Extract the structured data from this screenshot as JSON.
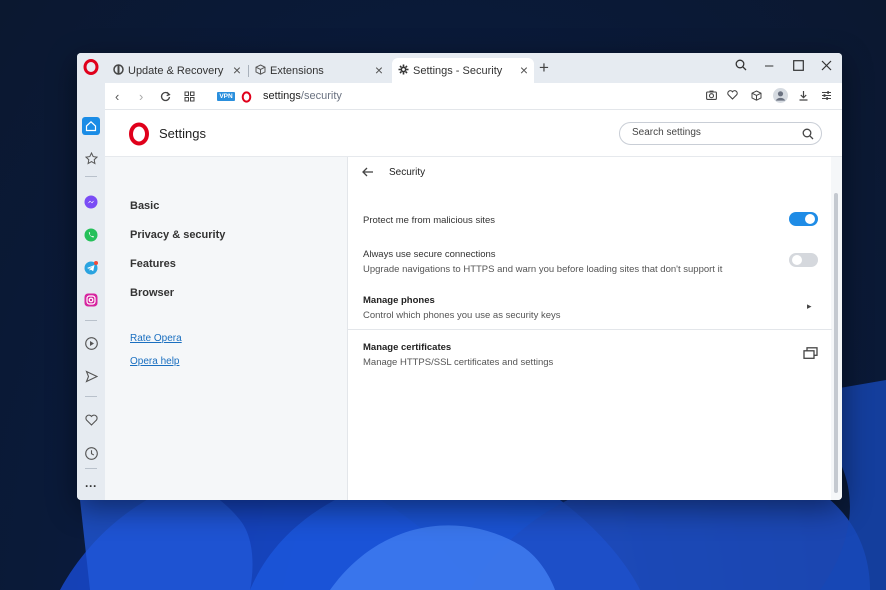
{
  "browser": {
    "tabs": [
      {
        "label": "Update & Recovery",
        "icon": "windows-settings-icon",
        "active": false
      },
      {
        "label": "Extensions",
        "icon": "cube-icon",
        "active": false
      },
      {
        "label": "Settings - Security",
        "icon": "gear-icon",
        "active": true
      }
    ],
    "address": {
      "vpn_badge": "VPN",
      "url_host": "settings",
      "url_path": "/security"
    }
  },
  "settings": {
    "title": "Settings",
    "search_placeholder": "Search settings",
    "nav": {
      "items": [
        "Basic",
        "Privacy & security",
        "Features",
        "Browser"
      ],
      "links": [
        "Rate Opera",
        "Opera help"
      ]
    },
    "page": {
      "title": "Security",
      "rows": [
        {
          "label": "Protect me from malicious sites",
          "control": "toggle",
          "on": true
        },
        {
          "label": "Always use secure connections",
          "description": "Upgrade navigations to HTTPS and warn you before loading sites that don't support it",
          "control": "toggle",
          "on": false
        },
        {
          "label": "Manage phones",
          "description": "Control which phones you use as security keys",
          "control": "chevron"
        },
        {
          "label": "Manage certificates",
          "description": "Manage HTTPS/SSL certificates and settings",
          "control": "external-link"
        }
      ]
    }
  },
  "colors": {
    "accent": "#1f8ce6",
    "opera_red": "#e0001b",
    "link": "#1a6fc0"
  }
}
